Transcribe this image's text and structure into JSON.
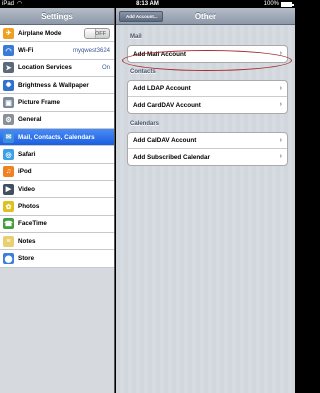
{
  "status_bar": {
    "carrier": "iPad",
    "wifi_icon": "wifi-icon",
    "time": "8:13 AM",
    "battery_percent": "100%",
    "battery_level": 1.0
  },
  "left_pane": {
    "title": "Settings",
    "items": [
      {
        "label": "Airplane Mode",
        "icon": "airplane-icon",
        "icon_color": "#f0a020",
        "glyph": "✈",
        "toggle": "OFF"
      },
      {
        "label": "Wi-Fi",
        "icon": "wifi-icon",
        "icon_color": "#3b7bd8",
        "glyph": "◠",
        "value": "myqwest3624"
      },
      {
        "label": "Location Services",
        "icon": "location-icon",
        "icon_color": "#5a6a7a",
        "glyph": "➤",
        "value": "On"
      },
      {
        "label": "Brightness & Wallpaper",
        "icon": "brightness-icon",
        "icon_color": "#3070d0",
        "glyph": "✹"
      },
      {
        "label": "Picture Frame",
        "icon": "picture-frame-icon",
        "icon_color": "#7a8a9a",
        "glyph": "▣"
      },
      {
        "label": "General",
        "icon": "gear-icon",
        "icon_color": "#8a8f98",
        "glyph": "⚙"
      },
      {
        "label": "Mail, Contacts, Calendars",
        "icon": "mail-icon",
        "icon_color": "#3c8de0",
        "glyph": "✉",
        "selected": true
      },
      {
        "label": "Safari",
        "icon": "safari-icon",
        "icon_color": "#3aa0e8",
        "glyph": "◎"
      },
      {
        "label": "iPod",
        "icon": "ipod-icon",
        "icon_color": "#f08020",
        "glyph": "♫"
      },
      {
        "label": "Video",
        "icon": "video-icon",
        "icon_color": "#405060",
        "glyph": "▶"
      },
      {
        "label": "Photos",
        "icon": "photos-icon",
        "icon_color": "#e0c020",
        "glyph": "✿"
      },
      {
        "label": "FaceTime",
        "icon": "facetime-icon",
        "icon_color": "#40a040",
        "glyph": "☎"
      },
      {
        "label": "Notes",
        "icon": "notes-icon",
        "icon_color": "#e8d070",
        "glyph": "≡"
      },
      {
        "label": "Store",
        "icon": "store-icon",
        "icon_color": "#3a80d8",
        "glyph": "⬤"
      }
    ]
  },
  "right_pane": {
    "back_button": "Add Account...",
    "title": "Other",
    "sections": [
      {
        "title": "Mail",
        "rows": [
          "Add Mail Account"
        ]
      },
      {
        "title": "Contacts",
        "rows": [
          "Add LDAP Account",
          "Add CardDAV Account"
        ]
      },
      {
        "title": "Calendars",
        "rows": [
          "Add CalDAV Account",
          "Add Subscribed Calendar"
        ]
      }
    ],
    "chevron_icon": "chevron-right-icon",
    "highlight_color": "#a62a2a"
  }
}
